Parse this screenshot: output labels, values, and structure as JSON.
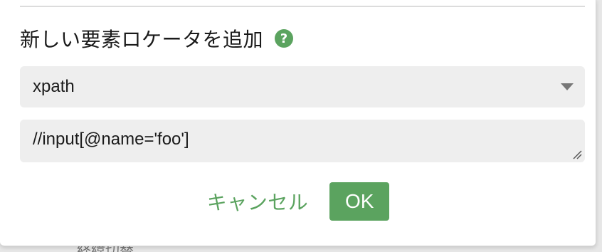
{
  "background": {
    "partial_text": "経緯切替"
  },
  "dialog": {
    "title": "新しい要素ロケータを追加",
    "help_icon_glyph": "?",
    "locator_type": {
      "selected": "xpath"
    },
    "locator_value": "//input[@name='foo']",
    "cancel_label": "キャンセル",
    "ok_label": "OK"
  },
  "colors": {
    "accent": "#5ba35f",
    "field_bg": "#eeeeee"
  },
  "icons": {
    "help": "question-circle-icon",
    "dropdown": "caret-down-icon",
    "resize": "resize-handle-icon"
  }
}
